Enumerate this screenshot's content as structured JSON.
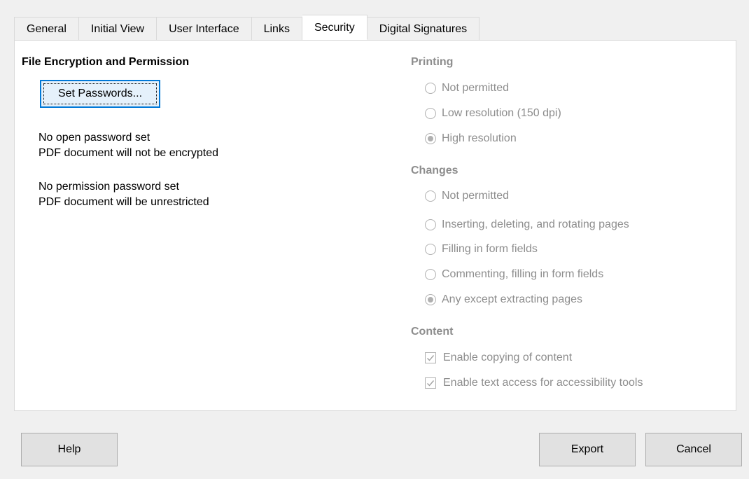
{
  "tabs": [
    "General",
    "Initial View",
    "User Interface",
    "Links",
    "Security",
    "Digital Signatures"
  ],
  "active_tab": "Security",
  "left": {
    "title": "File Encryption and Permission",
    "set_passwords_label": "Set Passwords...",
    "open_status_1": "No open password set",
    "open_status_2": "PDF document will not be encrypted",
    "perm_status_1": "No permission password set",
    "perm_status_2": "PDF document will be unrestricted"
  },
  "printing": {
    "title": "Printing",
    "options": [
      "Not permitted",
      "Low resolution (150 dpi)",
      "High resolution"
    ],
    "selected": "High resolution"
  },
  "changes": {
    "title": "Changes",
    "options": [
      "Not permitted",
      "Inserting, deleting, and rotating pages",
      "Filling in form fields",
      "Commenting, filling in form fields",
      "Any except extracting pages"
    ],
    "selected": "Any except extracting pages"
  },
  "content": {
    "title": "Content",
    "options": [
      "Enable copying of content",
      "Enable text access for accessibility tools"
    ],
    "checked": [
      true,
      true
    ]
  },
  "buttons": {
    "help": "Help",
    "export": "Export",
    "cancel": "Cancel"
  }
}
